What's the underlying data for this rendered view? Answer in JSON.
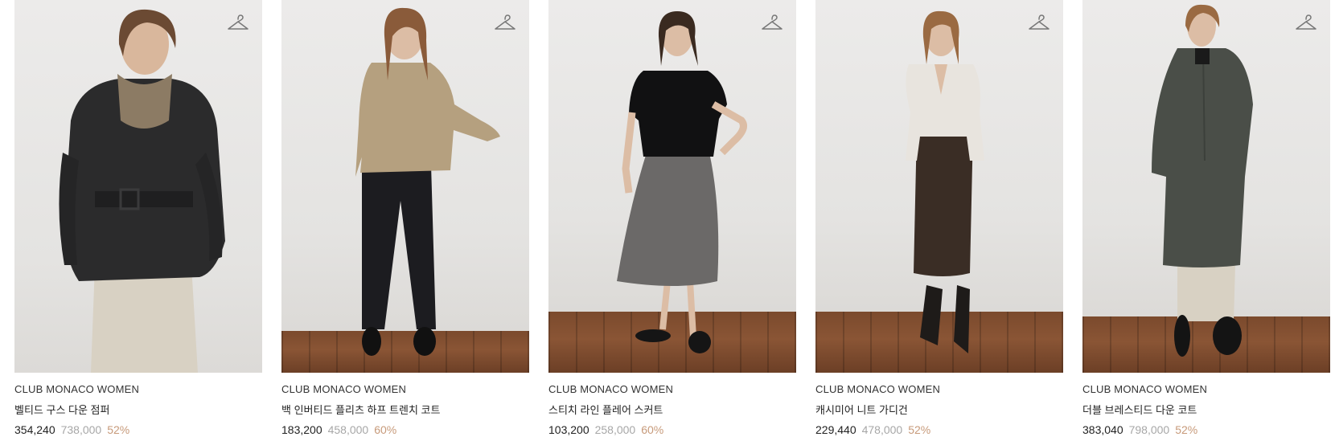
{
  "products": [
    {
      "brand": "CLUB MONACO WOMEN",
      "name": "벨티드 구스 다운 점퍼",
      "price": "354,240",
      "original_price": "738,000",
      "discount": "52%",
      "garment_color": "#2a2a2b",
      "icon": "hanger-icon"
    },
    {
      "brand": "CLUB MONACO WOMEN",
      "name": "백 인버티드 플리츠 하프 트렌치 코트",
      "price": "183,200",
      "original_price": "458,000",
      "discount": "60%",
      "garment_color": "#b09a7a",
      "icon": "hanger-icon"
    },
    {
      "brand": "CLUB MONACO WOMEN",
      "name": "스티치 라인 플레어 스커트",
      "price": "103,200",
      "original_price": "258,000",
      "discount": "60%",
      "garment_color": "#6a6867",
      "icon": "hanger-icon"
    },
    {
      "brand": "CLUB MONACO WOMEN",
      "name": "캐시미어 니트 가디건",
      "price": "229,440",
      "original_price": "478,000",
      "discount": "52%",
      "garment_color": "#e9e5df",
      "icon": "hanger-icon"
    },
    {
      "brand": "CLUB MONACO WOMEN",
      "name": "더블 브레스티드 다운 코트",
      "price": "383,040",
      "original_price": "798,000",
      "discount": "52%",
      "garment_color": "#4b4f49",
      "icon": "hanger-icon"
    }
  ],
  "colors": {
    "price_text": "#222222",
    "original_price_text": "#a7a7a7",
    "discount_text": "#c79a7a"
  }
}
